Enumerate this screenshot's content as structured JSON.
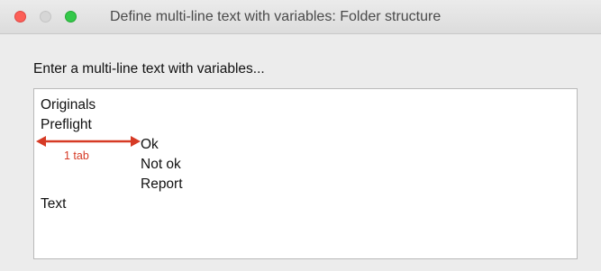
{
  "window": {
    "title": "Define multi-line text with variables: Folder structure"
  },
  "dialog": {
    "prompt": "Enter a multi-line text with variables...",
    "lines": [
      "Originals",
      "Preflight",
      "Ok",
      "Not ok",
      "Report",
      "Text"
    ]
  },
  "annotation": {
    "label": "1 tab",
    "color": "#d63a25"
  },
  "colors": {
    "close": "#fc5f57",
    "minimize": "#d6d6d6",
    "zoom": "#34c84a"
  }
}
